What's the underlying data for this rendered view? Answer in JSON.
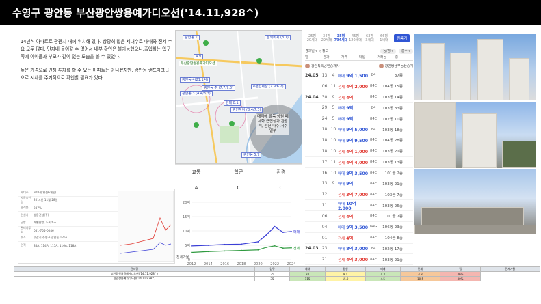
{
  "title": "수영구 광안동 부산광안쌍용예가디오션('14.11,928^)",
  "description": [
    "14년식 아파트로 광관지 내에 위치해 있다. 상당히 많은 세대수로 매매와 전세 수요 모두 많다. 단지내 들어갈 수 없어서 내부 확인은 불가능했으나,출입하는 입구쪽에 아이들과 부모가 같이 있는 모습을 볼 수 있었다.",
    "높은 가격으로 인해 투자를 할 수 있는 아파트는 아니겠지만, 광안동 랜드마크급으로 시세를 주기적으로 확인할 필요가 있다."
  ],
  "map": {
    "pins": [
      {
        "label": "광안동 1",
        "tone": "blue"
      },
      {
        "label": "4.9",
        "tone": "blue"
      },
      {
        "label": "부산광안쌍용예가디오션",
        "tone": "green"
      },
      {
        "label": "광안동 4(21.1억)",
        "tone": "blue"
      },
      {
        "label": "광안동 주 (7.7/7.3)",
        "tone": "blue"
      },
      {
        "label": "광안동 3 (4.4/3.3)",
        "tone": "blue"
      },
      {
        "label": "e편한세상 (7.9/6.2)",
        "tone": "blue"
      },
      {
        "label": "현대 8.1",
        "tone": "blue"
      },
      {
        "label": "광안자이 (8.4/7.3)",
        "tone": "blue"
      },
      {
        "label": "삼익비치 (8.1)",
        "tone": "blue"
      },
      {
        "label": "광안동 5.7",
        "tone": "blue"
      }
    ],
    "note": "대지에 골목 상권 폐세화 근접상가 관광객, 청년 다수 거주 일부"
  },
  "grades": {
    "headers": [
      "교통",
      "학군",
      "환경"
    ],
    "values": [
      "A",
      "C",
      "C"
    ]
  },
  "trades": {
    "sizes": [
      {
        "py": "25평",
        "sub": "20세대"
      },
      {
        "py": "34평",
        "sub": "29세대"
      },
      {
        "py": "35평",
        "sub": "794세대"
      },
      {
        "py": "45평",
        "sub": "120세대"
      },
      {
        "py": "63평",
        "sub": "3세대"
      },
      {
        "py": "66평",
        "sub": "1세대"
      }
    ],
    "active_size": 2,
    "button": "원룸기",
    "filter_left": "경과일 ▾  ◁ 정보",
    "filter_chips": [
      "동/평 ▾",
      "층수 ▾"
    ],
    "header": [
      "일",
      "경과",
      "가격",
      "타입",
      "거래동",
      "층"
    ],
    "agents": [
      "광안특특공인중개사",
      "광안쌍용부동산중개"
    ],
    "rows": [
      {
        "date": "24.05",
        "day": "13",
        "floor": "4",
        "kind": "매매",
        "price": "9억 1,500",
        "type": "84",
        "dong": "",
        "fl": "37층"
      },
      {
        "date": "",
        "day": "06",
        "floor": "11",
        "kind": "전세",
        "price": "4억 2,000",
        "type": "84E",
        "dong": "104동",
        "fl": "15층"
      },
      {
        "date": "24.04",
        "day": "30",
        "floor": "9",
        "kind": "전세",
        "price": "4억",
        "type": "84E",
        "dong": "103동",
        "fl": "14층"
      },
      {
        "date": "",
        "day": "29",
        "floor": "5",
        "kind": "매매",
        "price": "9억",
        "type": "84",
        "dong": "103동",
        "fl": "33층"
      },
      {
        "date": "",
        "day": "24",
        "floor": "5",
        "kind": "매매",
        "price": "9억",
        "type": "84E",
        "dong": "102동",
        "fl": "10층"
      },
      {
        "date": "",
        "day": "18",
        "floor": "10",
        "kind": "매매",
        "price": "9억 5,000",
        "type": "84",
        "dong": "103동",
        "fl": "18층"
      },
      {
        "date": "",
        "day": "18",
        "floor": "10",
        "kind": "매매",
        "price": "9억 9,500",
        "type": "84E",
        "dong": "104동",
        "fl": "28층"
      },
      {
        "date": "",
        "day": "18",
        "floor": "10",
        "kind": "전세",
        "price": "4억 1,000",
        "type": "84E",
        "dong": "103동",
        "fl": "21층"
      },
      {
        "date": "",
        "day": "17",
        "floor": "11",
        "kind": "전세",
        "price": "4억 4,000",
        "type": "84E",
        "dong": "103동",
        "fl": "13층"
      },
      {
        "date": "",
        "day": "16",
        "floor": "10",
        "kind": "매매",
        "price": "8억 3,500",
        "type": "84E",
        "dong": "101동",
        "fl": "2층"
      },
      {
        "date": "",
        "day": "13",
        "floor": "9",
        "kind": "매매",
        "price": "9억",
        "type": "84E",
        "dong": "103동",
        "fl": "21층"
      },
      {
        "date": "",
        "day": "12",
        "floor": "",
        "kind": "전세",
        "price": "3억 7,000",
        "type": "84E",
        "dong": "103동",
        "fl": "7층"
      },
      {
        "date": "",
        "day": "11",
        "floor": "",
        "kind": "매매",
        "price": "10억 2,000",
        "type": "84E",
        "dong": "103동",
        "fl": "26층"
      },
      {
        "date": "",
        "day": "06",
        "floor": "",
        "kind": "전세",
        "price": "4억",
        "type": "84E",
        "dong": "101동",
        "fl": "7층"
      },
      {
        "date": "",
        "day": "04",
        "floor": "",
        "kind": "매매",
        "price": "9억 3,500",
        "type": "84G",
        "dong": "106동",
        "fl": "23층"
      },
      {
        "date": "",
        "day": "01",
        "floor": "",
        "kind": "전세",
        "price": "4억",
        "type": "84E",
        "dong": "104동",
        "fl": "8층"
      },
      {
        "date": "24.03",
        "day": "23",
        "floor": "",
        "kind": "매매",
        "price": "8억 3,000",
        "type": "84",
        "dong": "102동",
        "fl": "17층"
      },
      {
        "date": "",
        "day": "21",
        "floor": "",
        "kind": "전세",
        "price": "4억 3,000",
        "type": "84E",
        "dong": "103동",
        "fl": "21층"
      }
    ]
  },
  "info_panel": {
    "rows": [
      {
        "k": "세대수",
        "v": "928세대(총6개동)"
      },
      {
        "k": "사용승인일",
        "v": "2014년 11월 28일"
      },
      {
        "k": "용적률",
        "v": "287%"
      },
      {
        "k": "건설사",
        "v": "쌍용건설(주)"
      },
      {
        "k": "난방",
        "v": "개별난방, 도시가스"
      },
      {
        "k": "관리사무소",
        "v": "051-755-0046"
      },
      {
        "k": "주소",
        "v": "부산시 수영구 광안동 1256"
      },
      {
        "k": "면적",
        "v": "85A, 114A, 115A, 116A, 118A"
      }
    ]
  },
  "chart_data": {
    "type": "line",
    "x": [
      2012,
      2014,
      2016,
      2018,
      2020,
      2021,
      2022,
      2023,
      2024
    ],
    "series": [
      {
        "name": "매매",
        "color": "#3b3fd6",
        "values": [
          4.8,
          5.0,
          5.3,
          5.4,
          6.2,
          8.6,
          11.5,
          9.5,
          9.8
        ]
      },
      {
        "name": "전세",
        "color": "#2f9a3f",
        "values": [
          2.5,
          2.8,
          3.0,
          3.2,
          3.4,
          4.3,
          4.8,
          4.0,
          4.1
        ]
      }
    ],
    "xticks": [
      "2012",
      "2014",
      "2016",
      "2018",
      "2020",
      "2022",
      "2024"
    ],
    "yticks": [
      "20억",
      "15억",
      "10억",
      "5억",
      "0"
    ],
    "ylim": [
      0,
      20
    ],
    "bottom_label": "전세가율"
  },
  "summary": {
    "col_groups": [
      "단지명",
      "입주",
      "세대",
      "평형",
      "매매",
      "전세",
      "갭",
      "전세가율"
    ],
    "rows": [
      [
        "부산광안쌍용예가디오션(’14.11,928^)",
        "35",
        "84",
        "9.1",
        "4.3",
        "4.8",
        "46%"
      ],
      [
        "광안쌍용예가디오션(’14.11,928^)",
        "35",
        "115",
        "15.0",
        "4.5",
        "10.5",
        "30%"
      ]
    ]
  },
  "colors": {
    "accent": "#2f55d4",
    "jeonse": "#e0362f",
    "title_bg": "#000000"
  }
}
